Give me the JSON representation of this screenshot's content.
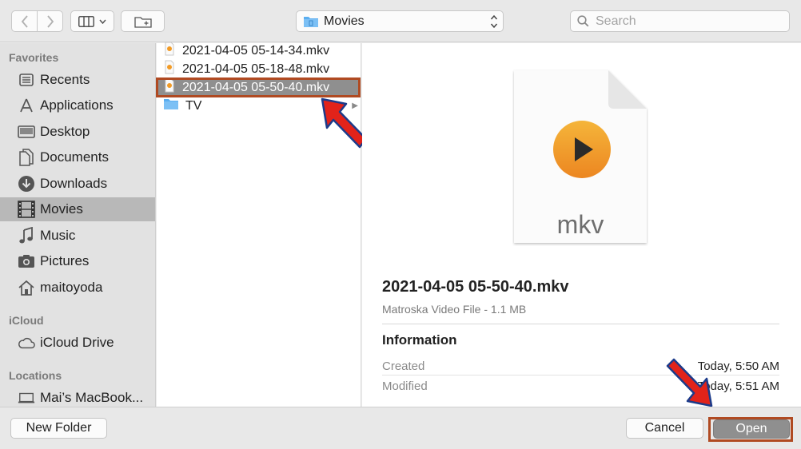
{
  "toolbar": {
    "back_icon": "chevron-left-icon",
    "forward_icon": "chevron-right-icon",
    "view_icon": "column-view-icon",
    "new_folder_icon": "new-folder-icon",
    "location": "Movies",
    "search_placeholder": "Search"
  },
  "sidebar": {
    "favorites_label": "Favorites",
    "favorites": [
      {
        "label": "Recents",
        "icon": "recents-icon"
      },
      {
        "label": "Applications",
        "icon": "applications-icon"
      },
      {
        "label": "Desktop",
        "icon": "desktop-icon"
      },
      {
        "label": "Documents",
        "icon": "documents-icon"
      },
      {
        "label": "Downloads",
        "icon": "downloads-icon"
      },
      {
        "label": "Movies",
        "icon": "movies-icon",
        "selected": true
      },
      {
        "label": "Music",
        "icon": "music-icon"
      },
      {
        "label": "Pictures",
        "icon": "pictures-icon"
      },
      {
        "label": "maitoyoda",
        "icon": "home-icon"
      }
    ],
    "icloud_label": "iCloud",
    "icloud": [
      {
        "label": "iCloud Drive",
        "icon": "cloud-icon"
      }
    ],
    "locations_label": "Locations",
    "locations": [
      {
        "label": "Mai’s MacBook...",
        "icon": "laptop-icon"
      }
    ]
  },
  "files": [
    {
      "name": "2021-04-05 05-14-34.mkv",
      "icon": "video-file-icon"
    },
    {
      "name": "2021-04-05 05-18-48.mkv",
      "icon": "video-file-icon"
    },
    {
      "name": "2021-04-05 05-50-40.mkv",
      "icon": "video-file-icon",
      "selected": true
    },
    {
      "name": "TV",
      "icon": "folder-icon"
    }
  ],
  "preview": {
    "ext": "mkv",
    "name": "2021-04-05 05-50-40.mkv",
    "kind": "Matroska Video File - 1.1 MB",
    "info_heading": "Information",
    "created_label": "Created",
    "created_value": "Today, 5:50 AM",
    "modified_label": "Modified",
    "modified_value": "Today, 5:51 AM"
  },
  "buttons": {
    "new_folder": "New Folder",
    "cancel": "Cancel",
    "open": "Open"
  },
  "colors": {
    "highlight_border": "#b04a22",
    "arrow_red": "#e2231a",
    "play_orange": "#f29b26"
  }
}
